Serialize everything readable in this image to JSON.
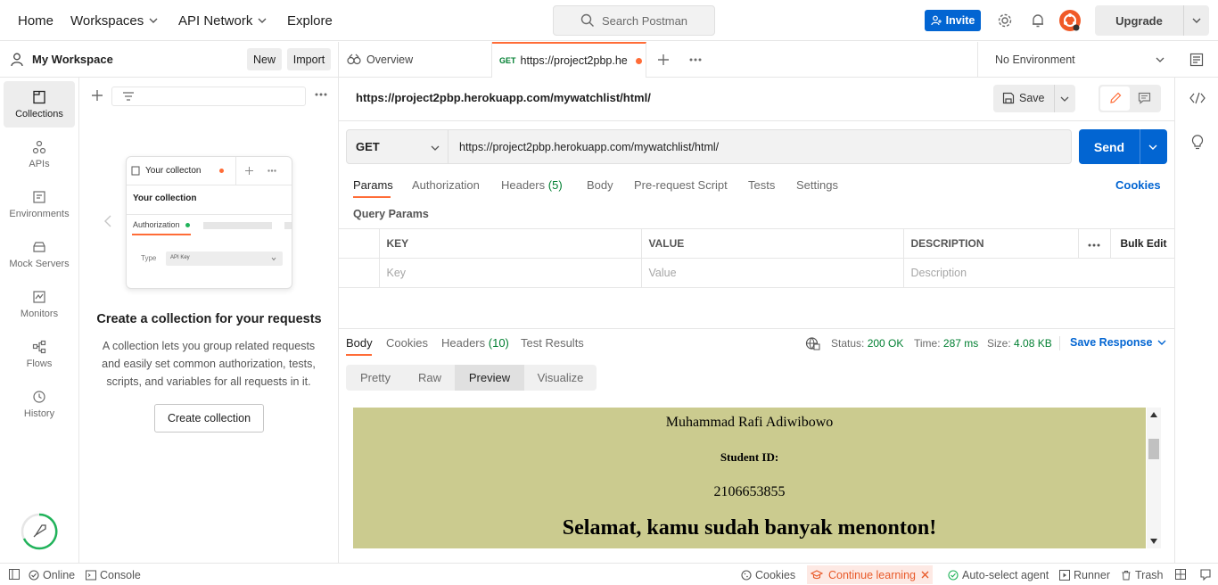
{
  "header": {
    "nav": [
      "Home",
      "Workspaces",
      "API Network",
      "Explore"
    ],
    "search_placeholder": "Search Postman",
    "invite_label": "Invite",
    "upgrade_label": "Upgrade"
  },
  "workspace": {
    "name": "My Workspace",
    "new_label": "New",
    "import_label": "Import"
  },
  "sidebar": {
    "items": [
      {
        "label": "Collections",
        "icon": "collections-icon"
      },
      {
        "label": "APIs",
        "icon": "apis-icon"
      },
      {
        "label": "Environments",
        "icon": "environments-icon"
      },
      {
        "label": "Mock Servers",
        "icon": "mock-servers-icon"
      },
      {
        "label": "Monitors",
        "icon": "monitors-icon"
      },
      {
        "label": "Flows",
        "icon": "flows-icon"
      },
      {
        "label": "History",
        "icon": "history-icon"
      }
    ]
  },
  "empty_state": {
    "card_title": "Your collecton",
    "card_heading": "Your collection",
    "card_tab": "Authorization",
    "card_type_label": "Type",
    "card_type_value": "API Key",
    "heading": "Create a collection for your requests",
    "description": "A collection lets you group related requests and easily set common authorization, tests, scripts, and variables for all requests in it.",
    "button": "Create collection"
  },
  "tabs": {
    "overview": "Overview",
    "request_method": "GET",
    "request_label": "https://project2pbp.he",
    "environment": "No Environment"
  },
  "request": {
    "title": "https://project2pbp.herokuapp.com/mywatchlist/html/",
    "save_label": "Save",
    "method": "GET",
    "url": "https://project2pbp.herokuapp.com/mywatchlist/html/",
    "send_label": "Send",
    "tabs": [
      "Params",
      "Authorization",
      "Headers",
      "Body",
      "Pre-request Script",
      "Tests",
      "Settings"
    ],
    "headers_count": "(5)",
    "cookies_link": "Cookies",
    "query_params_label": "Query Params",
    "table": {
      "columns": [
        "KEY",
        "VALUE",
        "DESCRIPTION"
      ],
      "bulk_edit": "Bulk Edit",
      "placeholders": [
        "Key",
        "Value",
        "Description"
      ]
    }
  },
  "response": {
    "tabs": [
      "Body",
      "Cookies",
      "Headers",
      "Test Results"
    ],
    "headers_count": "(10)",
    "status_label": "Status:",
    "status_value": "200 OK",
    "time_label": "Time:",
    "time_value": "287 ms",
    "size_label": "Size:",
    "size_value": "4.08 KB",
    "save_response": "Save Response",
    "view_modes": [
      "Pretty",
      "Raw",
      "Preview",
      "Visualize"
    ],
    "preview": {
      "name": "Muhammad Rafi Adiwibowo",
      "student_id_label": "Student ID:",
      "student_id": "2106653855",
      "message": "Selamat, kamu sudah banyak menonton!"
    }
  },
  "footer": {
    "online": "Online",
    "console": "Console",
    "cookies": "Cookies",
    "continue_learning": "Continue learning",
    "auto_select": "Auto-select agent",
    "runner": "Runner",
    "trash": "Trash"
  },
  "colors": {
    "accent_orange": "#ff6c37",
    "brand_blue": "#0265d2",
    "success_green": "#007f31",
    "preview_bg": "#cbcb8f"
  }
}
